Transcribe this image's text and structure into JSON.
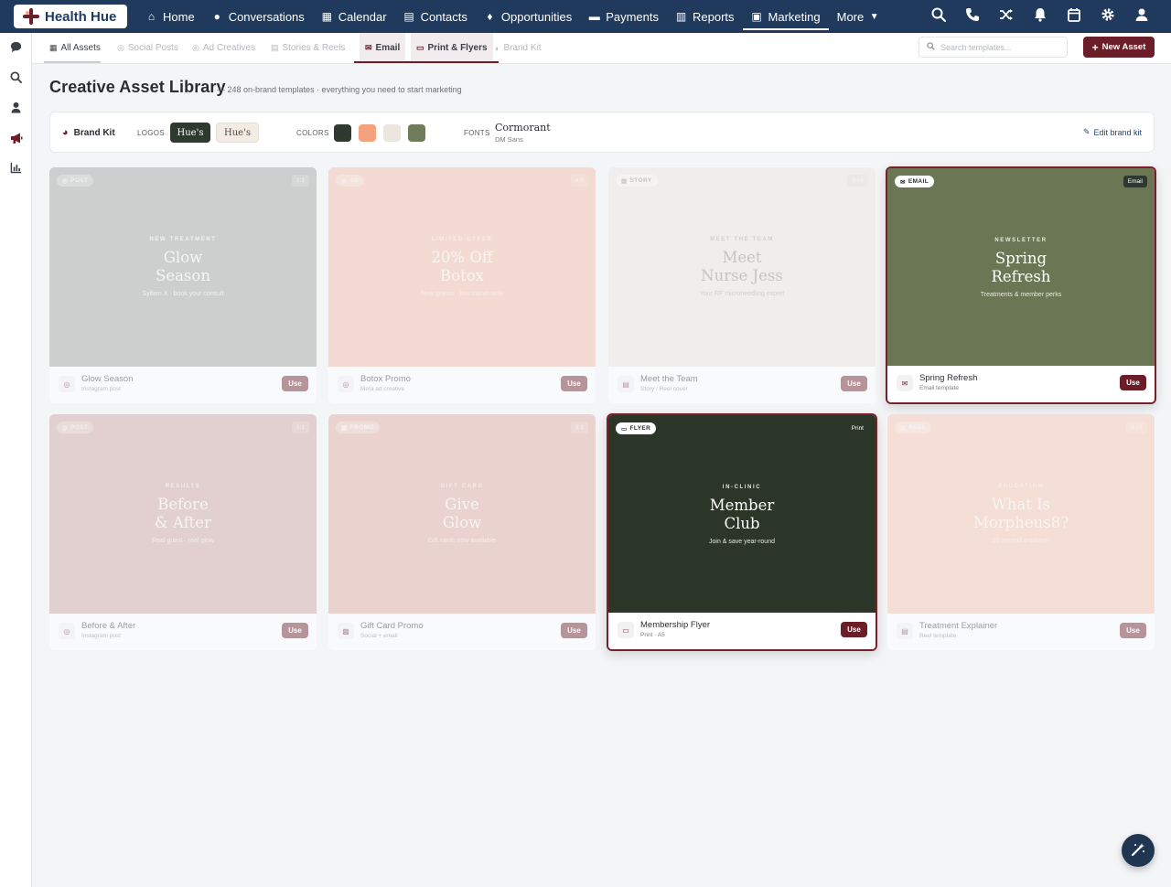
{
  "app": {
    "name": "Health Hue"
  },
  "nav": {
    "items": [
      {
        "label": "Home",
        "icon": "home-icon",
        "glyph": "⌂"
      },
      {
        "label": "Conversations",
        "icon": "chat-icon",
        "glyph": "💬"
      },
      {
        "label": "Calendar",
        "icon": "calendar-icon",
        "glyph": "▦"
      },
      {
        "label": "Contacts",
        "icon": "contacts-icon",
        "glyph": "▤"
      },
      {
        "label": "Opportunities",
        "icon": "lightbulb-icon",
        "glyph": "♦"
      },
      {
        "label": "Payments",
        "icon": "card-icon",
        "glyph": "▭"
      },
      {
        "label": "Reports",
        "icon": "bar-chart-icon",
        "glyph": "▥"
      },
      {
        "label": "Marketing",
        "icon": "marketing-icon",
        "glyph": "▣"
      },
      {
        "label": "More",
        "icon": "chevron-down-icon",
        "glyph": "▾"
      }
    ],
    "active": "Marketing"
  },
  "subtabs": {
    "items": [
      "All Assets",
      "Social Posts",
      "Ad Creatives",
      "Stories & Reels",
      "Email",
      "Print & Flyers",
      "Brand Kit"
    ]
  },
  "search": {
    "placeholder": "Search templates..."
  },
  "new_asset_label": "New Asset",
  "page": {
    "title": "Creative Asset Library",
    "subtitle": "— 248 on-brand templates · everything you need to start marketing"
  },
  "brandkit": {
    "label": "Brand Kit",
    "logos_label": "LOGOS",
    "logo_names": [
      "Hue's",
      "Hue's"
    ],
    "colors_label": "COLORS",
    "colors": [
      "#2e3a2f",
      "#f4a27e",
      "#ece6df",
      "#6f7d5d"
    ],
    "fonts_label": "FONTS",
    "font_primary": "Cormorant",
    "font_secondary": "DM Sans",
    "edit_label": "Edit brand kit"
  },
  "cards": [
    {
      "badge": "POST",
      "ratio": "1:1",
      "eyebrow": "NEW TREATMENT",
      "headline_1": "Glow",
      "headline_2": "Season",
      "tagline": "Sylfirm X · book your consult",
      "name": "Glow Season",
      "sub": "Instagram post",
      "use": "Use"
    },
    {
      "badge": "AD",
      "ratio": "4:5",
      "eyebrow": "LIMITED OFFER",
      "headline_1": "20% Off",
      "headline_2": "Botox",
      "tagline": "New guests · this month only",
      "name": "Botox Promo",
      "sub": "Meta ad creative",
      "use": "Use"
    },
    {
      "badge": "STORY",
      "ratio": "9:16",
      "eyebrow": "MEET THE TEAM",
      "headline_1": "Meet",
      "headline_2": "Nurse Jess",
      "tagline": "Your RF microneedling expert",
      "name": "Meet the Team",
      "sub": "Story / Reel cover",
      "use": "Use"
    },
    {
      "badge": "EMAIL",
      "ratio": "Email",
      "eyebrow": "NEWSLETTER",
      "headline_1": "Spring",
      "headline_2": "Refresh",
      "tagline": "Treatments & member perks",
      "name": "Spring Refresh",
      "sub": "Email template",
      "use": "Use"
    },
    {
      "badge": "POST",
      "ratio": "1:1",
      "eyebrow": "RESULTS",
      "headline_1": "Before",
      "headline_2": "& After",
      "tagline": "Real guest · real glow",
      "name": "Before & After",
      "sub": "Instagram post",
      "use": "Use"
    },
    {
      "badge": "PROMO",
      "ratio": "1:1",
      "eyebrow": "GIFT CARD",
      "headline_1": "Give",
      "headline_2": "Glow",
      "tagline": "Gift cards now available",
      "name": "Gift Card Promo",
      "sub": "Social + email",
      "use": "Use"
    },
    {
      "badge": "FLYER",
      "ratio": "Print",
      "eyebrow": "IN-CLINIC",
      "headline_1": "Member",
      "headline_2": "Club",
      "tagline": "Join & save year-round",
      "name": "Membership Flyer",
      "sub": "Print · A5",
      "use": "Use"
    },
    {
      "badge": "REEL",
      "ratio": "9:16",
      "eyebrow": "EDUCATION",
      "headline_1": "What Is",
      "headline_2": "Morpheus8?",
      "tagline": "60-second explainer",
      "name": "Treatment Explainer",
      "sub": "Reel template",
      "use": "Use"
    }
  ]
}
